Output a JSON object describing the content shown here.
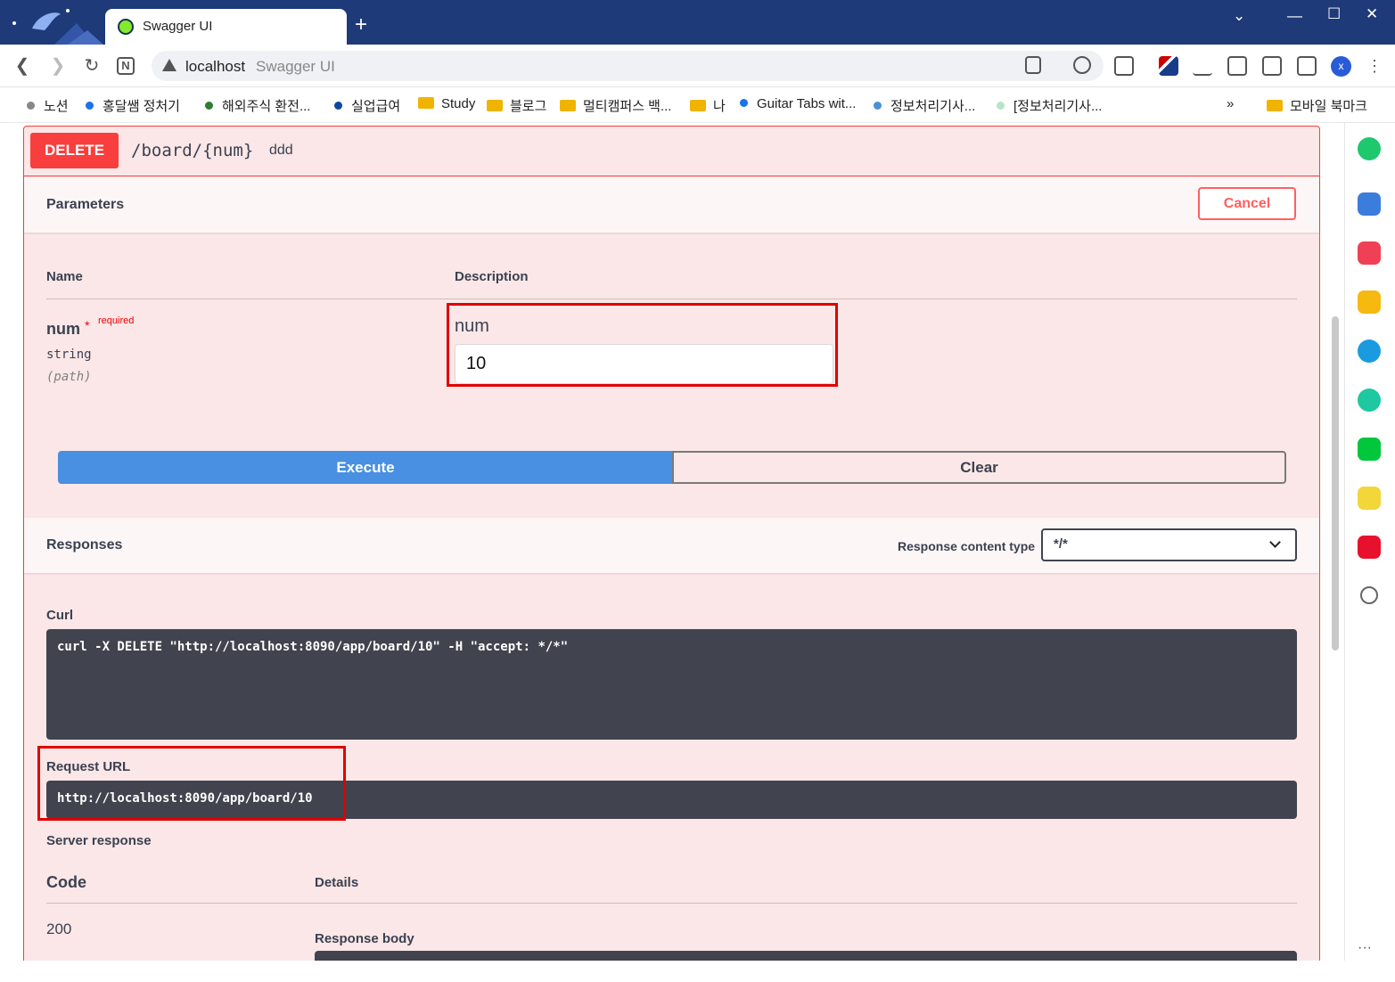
{
  "browser": {
    "tab_title": "Swagger UI",
    "new_tab": "+",
    "url_host": "localhost",
    "url_path": "Swagger UI",
    "profile_initial": "x"
  },
  "bookmarks": [
    {
      "label": "노션",
      "kind": "dot",
      "color": "#888888"
    },
    {
      "label": "홍달쌤 정처기",
      "kind": "dot",
      "color": "#1a73e8"
    },
    {
      "label": "해외주식 환전...",
      "kind": "dot",
      "color": "#2e7d32"
    },
    {
      "label": "실업급여",
      "kind": "dot",
      "color": "#0d47a1"
    },
    {
      "label": "Study",
      "kind": "folder"
    },
    {
      "label": "블로그",
      "kind": "folder"
    },
    {
      "label": "멀티캠퍼스 백...",
      "kind": "folder"
    },
    {
      "label": "나",
      "kind": "folder"
    },
    {
      "label": "Guitar Tabs wit...",
      "kind": "dot",
      "color": "#1a73e8"
    },
    {
      "label": "정보처리기사...",
      "kind": "dot",
      "color": "#4a90d9"
    },
    {
      "label": "[정보처리기사...",
      "kind": "dot",
      "color": "#b7e4c7"
    },
    {
      "label": "»",
      "kind": "more"
    },
    {
      "label": "모바일 북마크",
      "kind": "folder"
    }
  ],
  "operation": {
    "method": "DELETE",
    "path": "/board/{num}",
    "description": "ddd"
  },
  "parameters": {
    "title": "Parameters",
    "cancel_label": "Cancel",
    "col_name": "Name",
    "col_description": "Description",
    "param": {
      "name": "num",
      "required_star": "*",
      "required_text": "required",
      "type": "string",
      "in": "(path)",
      "description": "num",
      "value": "10"
    }
  },
  "actions": {
    "execute_label": "Execute",
    "clear_label": "Clear"
  },
  "responses": {
    "title": "Responses",
    "content_type_label": "Response content type",
    "content_type_value": "*/*",
    "curl_label": "Curl",
    "curl_command": "curl -X DELETE \"http://localhost:8090/app/board/10\" -H \"accept: */*\"",
    "request_url_label": "Request URL",
    "request_url": "http://localhost:8090/app/board/10",
    "server_response_label": "Server response",
    "code_header": "Code",
    "details_header": "Details",
    "code_value": "200",
    "response_body_label": "Response body"
  },
  "colors": {
    "delete_accent": "#f93e3e",
    "execute_blue": "#4990e2",
    "highlight_red": "#e00000",
    "code_bg": "#41444e"
  }
}
